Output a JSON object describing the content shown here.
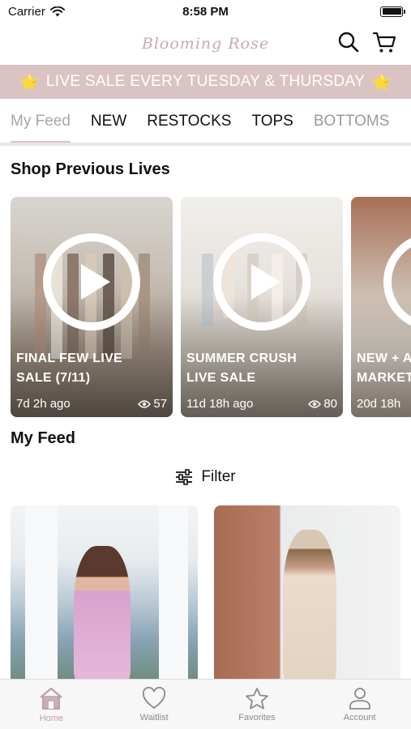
{
  "status_bar": {
    "carrier": "Carrier",
    "time": "8:58 PM"
  },
  "header": {
    "logo": "Blooming Rose",
    "search_icon": "search-icon",
    "cart_icon": "cart-icon"
  },
  "banner": {
    "star": "⭐",
    "text": "LIVE SALE EVERY TUESDAY & THURSDAY"
  },
  "tabs": [
    {
      "label": "My Feed",
      "active": true
    },
    {
      "label": "NEW"
    },
    {
      "label": "RESTOCKS"
    },
    {
      "label": "TOPS"
    },
    {
      "label": "BOTTOMS"
    }
  ],
  "previous_lives": {
    "title": "Shop Previous Lives",
    "items": [
      {
        "title": "FINAL FEW LIVE\nSALE (7/11)",
        "age": "7d 2h ago",
        "views": "57"
      },
      {
        "title": "SUMMER CRUSH\nLIVE SALE",
        "age": "11d 18h ago",
        "views": "80"
      },
      {
        "title": "NEW + A\nMARKET",
        "age": "20d 18h",
        "views": ""
      }
    ]
  },
  "feed": {
    "title": "My Feed",
    "filter_label": "Filter"
  },
  "bottom_nav": [
    {
      "label": "Home",
      "icon": "home-icon",
      "active": true
    },
    {
      "label": "Waitlist",
      "icon": "heart-icon"
    },
    {
      "label": "Favorites",
      "icon": "star-icon"
    },
    {
      "label": "Account",
      "icon": "person-icon"
    }
  ],
  "colors": {
    "accent": "#d9c4c3",
    "active_tab_text": "#a6a6a6",
    "nav_active": "#b9a2a6"
  }
}
